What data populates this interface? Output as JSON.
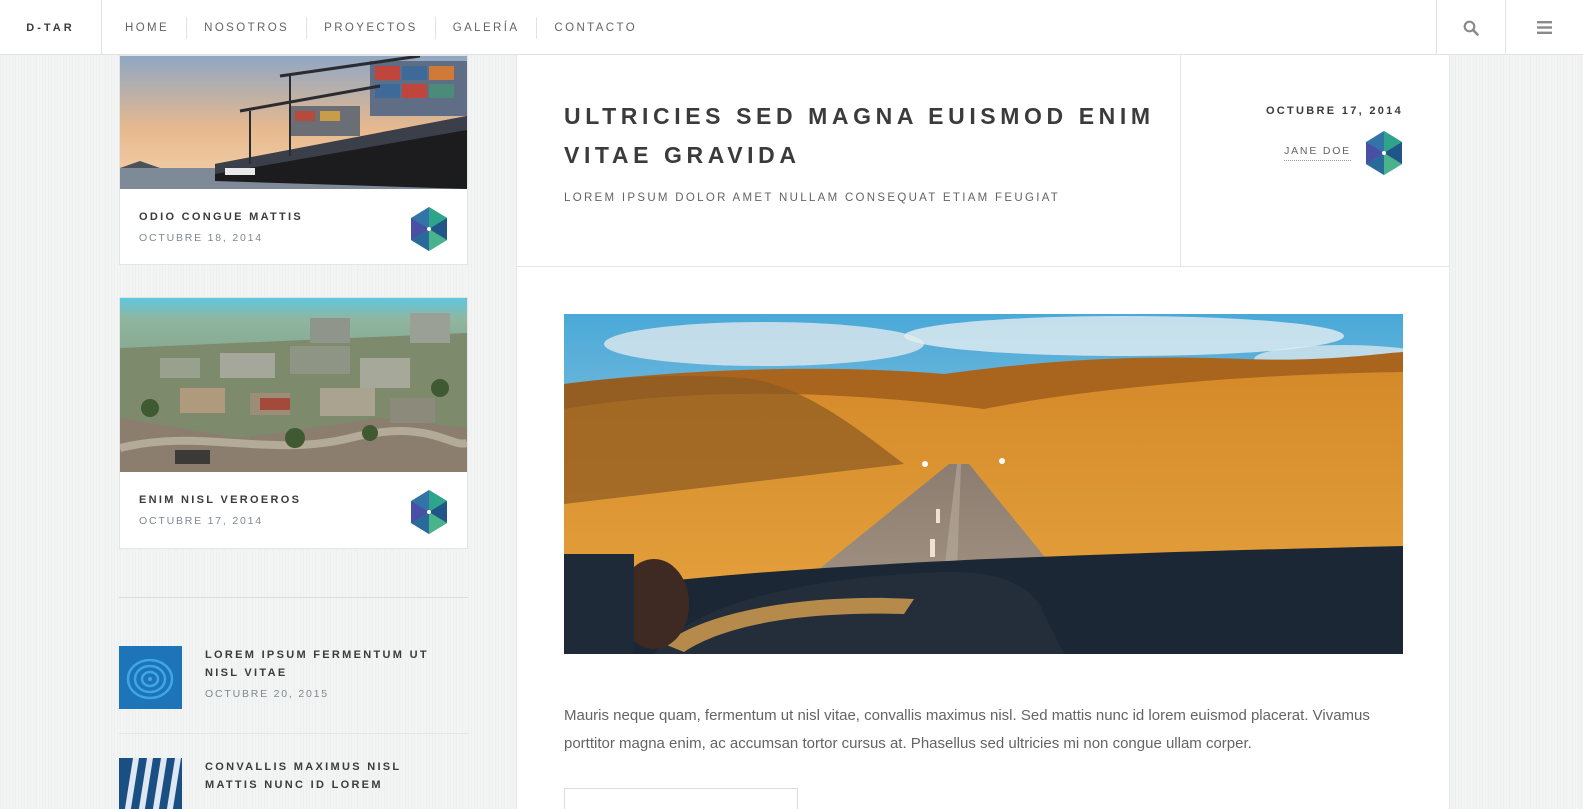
{
  "header": {
    "logo": "D-TAR",
    "nav": [
      {
        "label": "HOME"
      },
      {
        "label": "NOSOTROS"
      },
      {
        "label": "PROYECTOS"
      },
      {
        "label": "GALERÍA"
      },
      {
        "label": "CONTACTO"
      }
    ],
    "search_icon": "search-icon",
    "menu_icon": "hamburger-menu-icon"
  },
  "sidebar": {
    "cards": [
      {
        "title": "ODIO CONGUE MATTIS",
        "date": "OCTUBRE 18, 2014",
        "image": "cargo-ship-at-port"
      },
      {
        "title": "ENIM NISL VEROEROS",
        "date": "OCTUBRE 17, 2014",
        "image": "aerial-city-game-render"
      }
    ],
    "mini_posts": [
      {
        "title": "LOREM IPSUM FERMENTUM UT NISL VITAE",
        "date": "OCTUBRE 20, 2015",
        "image": "blue-fingerprint"
      },
      {
        "title": "CONVALLIS MAXIMUS NISL MATTIS NUNC ID LOREM",
        "date": "",
        "image": "blue-abstract"
      }
    ]
  },
  "post": {
    "title": "ULTRICIES SED MAGNA EUISMOD ENIM VITAE GRAVIDA",
    "subtitle": "LOREM IPSUM DOLOR AMET NULLAM CONSEQUAT ETIAM FEUGIAT",
    "date": "OCTUBRE 17, 2014",
    "author": "JANE DOE",
    "image": "desert-road-through-windshield",
    "body": "Mauris neque quam, fermentum ut nisl vitae, convallis maximus nisl. Sed mattis nunc id lorem euismod placerat. Vivamus porttitor magna enim, ac accumsan tortor cursus at. Phasellus sed ultricies mi non congue ullam corper."
  },
  "colors": {
    "accent_blue": "#2d6fa3",
    "accent_green": "#3ea07a",
    "text_dark": "#3c3b3b",
    "text_muted": "#7f888f"
  }
}
